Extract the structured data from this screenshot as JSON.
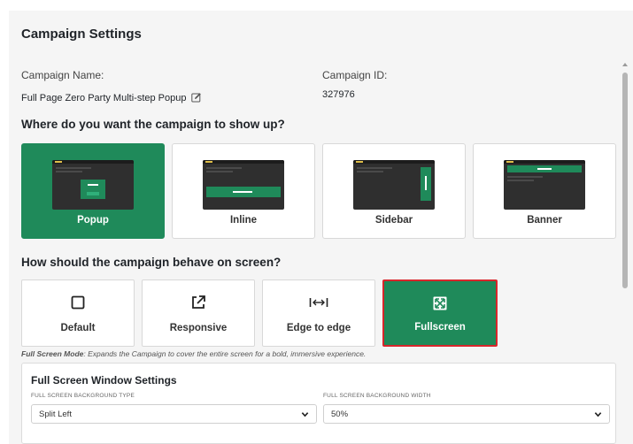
{
  "header": {
    "title": "Campaign Settings"
  },
  "campaign": {
    "name_label": "Campaign Name:",
    "name_value": "Full Page Zero Party Multi-step Popup",
    "id_label": "Campaign ID:",
    "id_value": "327976"
  },
  "placement": {
    "question": "Where do you want the campaign to show up?",
    "selected": "Popup",
    "options": [
      {
        "label": "Popup",
        "thumb_text": [
          "POPUP",
          "BUTTON"
        ]
      },
      {
        "label": "Inline",
        "thumb_text": [
          "INNERBANNER"
        ]
      },
      {
        "label": "Sidebar",
        "thumb_text": [
          "SIDEBAR"
        ]
      },
      {
        "label": "Banner",
        "thumb_text": [
          "BANNER"
        ]
      }
    ]
  },
  "behavior": {
    "question": "How should the campaign behave on screen?",
    "selected": "Fullscreen",
    "options": [
      {
        "label": "Default",
        "icon": "square-icon"
      },
      {
        "label": "Responsive",
        "icon": "external-link-icon"
      },
      {
        "label": "Edge to edge",
        "icon": "horizontal-arrows-icon"
      },
      {
        "label": "Fullscreen",
        "icon": "expand-icon"
      }
    ]
  },
  "mode_note": {
    "title": "Full Screen Mode",
    "text": ": Expands the Campaign to cover the entire screen for a bold, immersive experience."
  },
  "fullscreen_settings": {
    "title": "Full Screen Window Settings",
    "bg_type_label": "FULL SCREEN BACKGROUND TYPE",
    "bg_type_value": "Split Left",
    "bg_width_label": "FULL SCREEN BACKGROUND WIDTH",
    "bg_width_value": "50%"
  },
  "colors": {
    "accent": "#1f8a5a",
    "selected_outline": "#d8262b",
    "panel_bg": "#f5f5f5"
  }
}
